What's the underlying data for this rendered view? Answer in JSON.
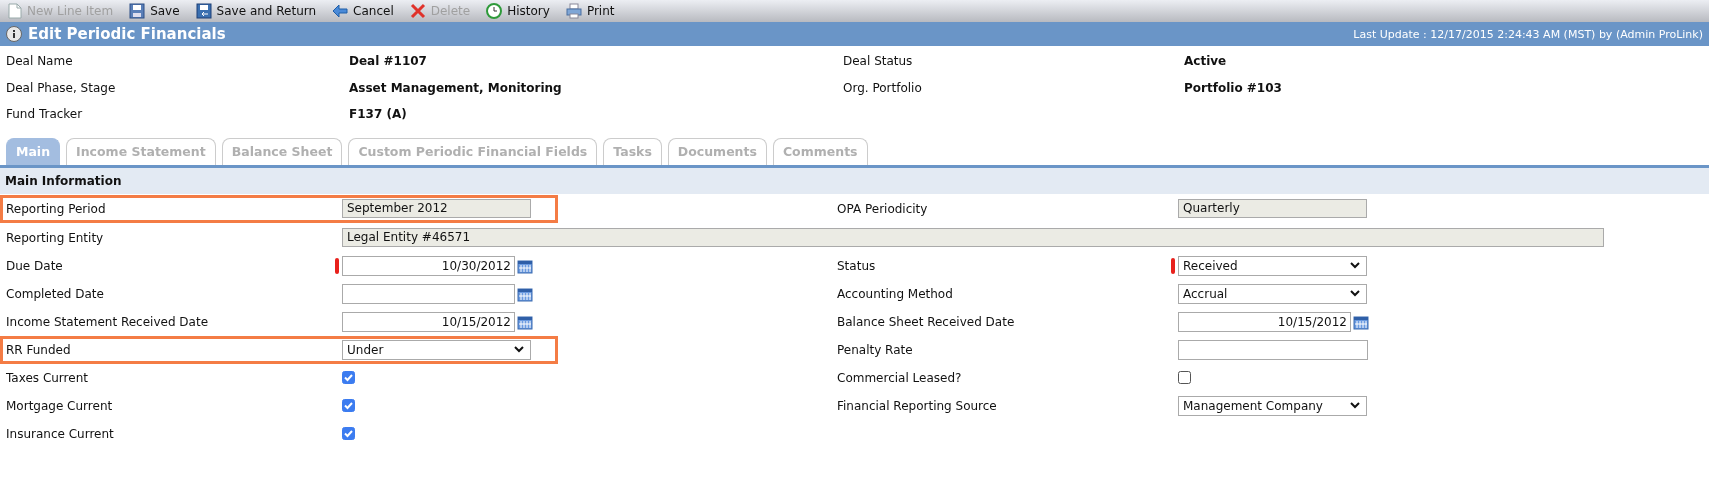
{
  "toolbar": [
    {
      "kind": "new",
      "label": "New Line Item",
      "disabled": true
    },
    {
      "kind": "save",
      "label": "Save",
      "disabled": false
    },
    {
      "kind": "save_return",
      "label": "Save and Return",
      "disabled": false
    },
    {
      "kind": "cancel",
      "label": "Cancel",
      "disabled": false
    },
    {
      "kind": "delete",
      "label": "Delete",
      "disabled": true
    },
    {
      "kind": "history",
      "label": "History",
      "disabled": false
    },
    {
      "kind": "print",
      "label": "Print",
      "disabled": false
    }
  ],
  "title_bar": {
    "title": "Edit Periodic Financials",
    "last_update": "Last Update : 12/17/2015 2:24:43 AM (MST) by (Admin ProLink)"
  },
  "header": [
    {
      "label": "Deal Name",
      "value": "Deal #1107"
    },
    {
      "label": "Deal Status",
      "value": "Active"
    },
    {
      "label": "Deal Phase, Stage",
      "value": "Asset Management, Monitoring"
    },
    {
      "label": "Org. Portfolio",
      "value": "Portfolio #103"
    },
    {
      "label": "Fund Tracker",
      "value": "F137 (A)"
    }
  ],
  "tabs": [
    {
      "label": "Main",
      "selected": true
    },
    {
      "label": "Income Statement",
      "selected": false
    },
    {
      "label": "Balance Sheet",
      "selected": false
    },
    {
      "label": "Custom Periodic Financial Fields",
      "selected": false
    },
    {
      "label": "Tasks",
      "selected": false
    },
    {
      "label": "Documents",
      "selected": false
    },
    {
      "label": "Comments",
      "selected": false
    }
  ],
  "section": {
    "title": "Main Information",
    "rows": [
      {
        "left": {
          "label": "Reporting Period",
          "kind": "readonly",
          "value": "September 2012",
          "required": false,
          "highlighted": true
        },
        "right": {
          "label": "OPA Periodicity",
          "kind": "readonly",
          "value": "Quarterly",
          "required": false
        }
      },
      {
        "left": {
          "label": "Reporting Entity",
          "kind": "readonly_wide",
          "value": "Legal Entity #46571",
          "required": false,
          "highlighted": false
        }
      },
      {
        "left": {
          "label": "Due Date",
          "kind": "date",
          "value": "10/30/2012",
          "required": true,
          "highlighted": false
        },
        "right": {
          "label": "Status",
          "kind": "select",
          "value": "Received",
          "required": true
        }
      },
      {
        "left": {
          "label": "Completed Date",
          "kind": "date",
          "required": false,
          "highlighted": false
        },
        "right": {
          "label": "Accounting Method",
          "kind": "select",
          "value": "Accrual",
          "required": false
        }
      },
      {
        "left": {
          "label": "Income Statement Received Date",
          "kind": "date",
          "value": "10/15/2012",
          "required": false,
          "highlighted": false
        },
        "right": {
          "label": "Balance Sheet Received Date",
          "kind": "date",
          "value": "10/15/2012",
          "required": false
        }
      },
      {
        "left": {
          "label": "RR Funded",
          "kind": "select",
          "value": "Under",
          "required": false,
          "highlighted": true
        },
        "right": {
          "label": "Penalty Rate",
          "kind": "text",
          "required": false
        }
      },
      {
        "left": {
          "label": "Taxes Current",
          "kind": "checkbox",
          "checked": true,
          "required": false,
          "highlighted": false
        },
        "right": {
          "label": "Commercial Leased?",
          "kind": "checkbox",
          "checked": false,
          "required": false
        }
      },
      {
        "left": {
          "label": "Mortgage Current",
          "kind": "checkbox",
          "checked": true,
          "required": false,
          "highlighted": false
        },
        "right": {
          "label": "Financial Reporting Source",
          "kind": "select",
          "value": "Management Company",
          "required": false
        }
      },
      {
        "left": {
          "label": "Insurance Current",
          "kind": "checkbox",
          "checked": true,
          "required": false,
          "highlighted": false
        }
      }
    ]
  }
}
